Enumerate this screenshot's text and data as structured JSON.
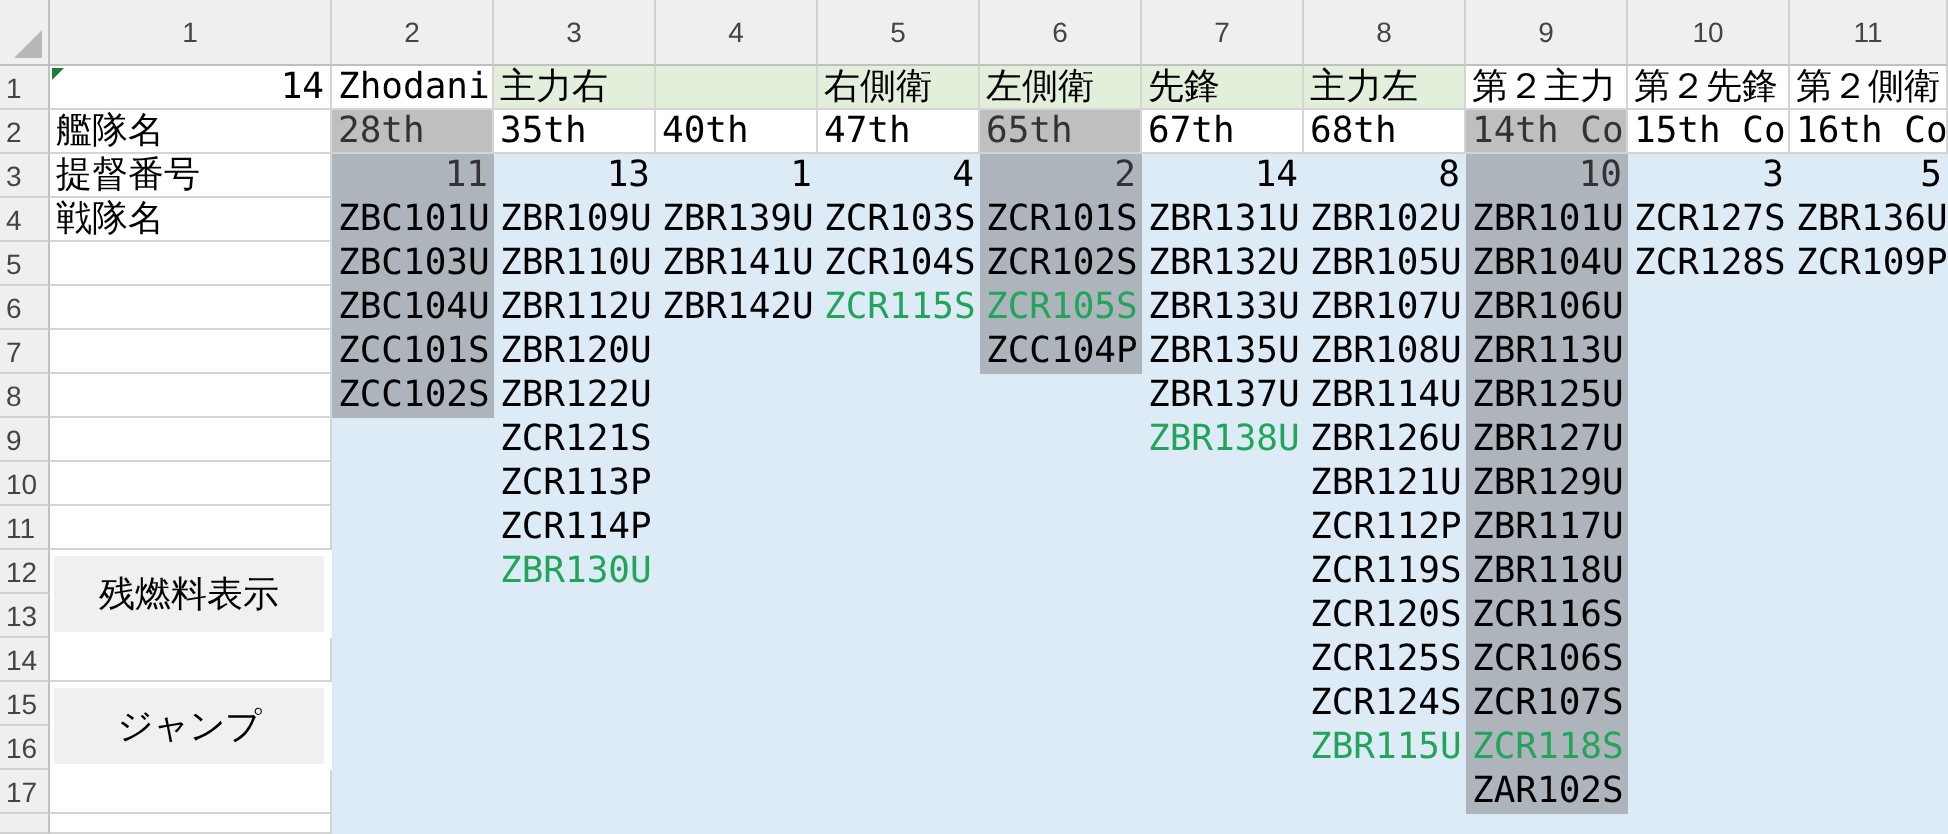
{
  "column_headers": [
    "1",
    "2",
    "3",
    "4",
    "5",
    "6",
    "7",
    "8",
    "9",
    "10",
    "11"
  ],
  "row_headers": [
    "1",
    "2",
    "3",
    "4",
    "5",
    "6",
    "7",
    "8",
    "9",
    "10",
    "11",
    "12",
    "13",
    "14",
    "15",
    "16",
    "17"
  ],
  "corner_value": "14",
  "row_labels": [
    "艦隊名",
    "提督番号",
    "戦隊名"
  ],
  "buttons": [
    "残燃料表示",
    "ジャンプ"
  ],
  "squadrons": [
    {
      "title": "Zhodani",
      "title_highlight": false,
      "fleet": "28th",
      "count": "11",
      "selected": true,
      "ships": [
        {
          "name": "ZBC101U",
          "color": "#000000"
        },
        {
          "name": "ZBC103U",
          "color": "#000000"
        },
        {
          "name": "ZBC104U",
          "color": "#000000"
        },
        {
          "name": "ZCC101S",
          "color": "#000000"
        },
        {
          "name": "ZCC102S",
          "color": "#000000"
        }
      ]
    },
    {
      "title": "主力右",
      "title_highlight": true,
      "fleet": "35th",
      "count": "13",
      "selected": false,
      "ships": [
        {
          "name": "ZBR109U",
          "color": "#000000"
        },
        {
          "name": "ZBR110U",
          "color": "#000000"
        },
        {
          "name": "ZBR112U",
          "color": "#000000"
        },
        {
          "name": "ZBR120U",
          "color": "#000000"
        },
        {
          "name": "ZBR122U",
          "color": "#000000"
        },
        {
          "name": "ZCR121S",
          "color": "#000000"
        },
        {
          "name": "ZCR113P",
          "color": "#000000"
        },
        {
          "name": "ZCR114P",
          "color": "#000000"
        },
        {
          "name": "ZBR130U",
          "color": "#22a55a"
        }
      ]
    },
    {
      "title_highlight": true,
      "fleet": "40th",
      "count": "1",
      "selected": false,
      "ships": [
        {
          "name": "ZBR139U",
          "color": "#000000"
        },
        {
          "name": "ZBR141U",
          "color": "#000000"
        },
        {
          "name": "ZBR142U",
          "color": "#000000"
        }
      ]
    },
    {
      "title": "右側衛",
      "title_highlight": true,
      "fleet": "47th",
      "count": "4",
      "selected": false,
      "ships": [
        {
          "name": "ZCR103S",
          "color": "#000000"
        },
        {
          "name": "ZCR104S",
          "color": "#000000"
        },
        {
          "name": "ZCR115S",
          "color": "#22a55a"
        }
      ]
    },
    {
      "title": "左側衛",
      "title_highlight": true,
      "fleet": "65th",
      "count": "2",
      "selected": true,
      "ships": [
        {
          "name": "ZCR101S",
          "color": "#000000"
        },
        {
          "name": "ZCR102S",
          "color": "#000000"
        },
        {
          "name": "ZCR105S",
          "color": "#22a55a"
        },
        {
          "name": "ZCC104P",
          "color": "#000000"
        }
      ]
    },
    {
      "title": "先鋒",
      "title_highlight": true,
      "fleet": "67th",
      "count": "14",
      "selected": false,
      "ships": [
        {
          "name": "ZBR131U",
          "color": "#000000"
        },
        {
          "name": "ZBR132U",
          "color": "#000000"
        },
        {
          "name": "ZBR133U",
          "color": "#000000"
        },
        {
          "name": "ZBR135U",
          "color": "#000000"
        },
        {
          "name": "ZBR137U",
          "color": "#000000"
        },
        {
          "name": "ZBR138U",
          "color": "#22a55a"
        }
      ]
    },
    {
      "title": "主力左",
      "title_highlight": true,
      "fleet": "68th",
      "count": "8",
      "selected": false,
      "ships": [
        {
          "name": "ZBR102U",
          "color": "#000000"
        },
        {
          "name": "ZBR105U",
          "color": "#000000"
        },
        {
          "name": "ZBR107U",
          "color": "#000000"
        },
        {
          "name": "ZBR108U",
          "color": "#000000"
        },
        {
          "name": "ZBR114U",
          "color": "#000000"
        },
        {
          "name": "ZBR126U",
          "color": "#000000"
        },
        {
          "name": "ZBR121U",
          "color": "#000000"
        },
        {
          "name": "ZCR112P",
          "color": "#000000"
        },
        {
          "name": "ZCR119S",
          "color": "#000000"
        },
        {
          "name": "ZCR120S",
          "color": "#000000"
        },
        {
          "name": "ZCR125S",
          "color": "#000000"
        },
        {
          "name": "ZCR124S",
          "color": "#000000"
        },
        {
          "name": "ZBR115U",
          "color": "#22a55a"
        }
      ]
    },
    {
      "title": "第２主力",
      "title_highlight": false,
      "fleet": "14th Co",
      "count": "10",
      "selected": true,
      "ships": [
        {
          "name": "ZBR101U",
          "color": "#000000"
        },
        {
          "name": "ZBR104U",
          "color": "#000000"
        },
        {
          "name": "ZBR106U",
          "color": "#000000"
        },
        {
          "name": "ZBR113U",
          "color": "#000000"
        },
        {
          "name": "ZBR125U",
          "color": "#000000"
        },
        {
          "name": "ZBR127U",
          "color": "#000000"
        },
        {
          "name": "ZBR129U",
          "color": "#000000"
        },
        {
          "name": "ZBR117U",
          "color": "#000000"
        },
        {
          "name": "ZBR118U",
          "color": "#000000"
        },
        {
          "name": "ZCR116S",
          "color": "#000000"
        },
        {
          "name": "ZCR106S",
          "color": "#000000"
        },
        {
          "name": "ZCR107S",
          "color": "#000000"
        },
        {
          "name": "ZCR118S",
          "color": "#22a55a"
        },
        {
          "name": "ZAR102S",
          "color": "#000000"
        }
      ]
    },
    {
      "title": "第２先鋒",
      "title_highlight": false,
      "fleet": "15th Co",
      "count": "3",
      "selected": false,
      "ships": [
        {
          "name": "ZCR127S",
          "color": "#000000"
        },
        {
          "name": "ZCR128S",
          "color": "#000000"
        }
      ]
    },
    {
      "title": "第２側衛",
      "title_highlight": false,
      "fleet": "16th Co",
      "count": "5",
      "selected": false,
      "ships": [
        {
          "name": "ZBR136U",
          "color": "#000000"
        },
        {
          "name": "ZCR109P",
          "color": "#000000"
        }
      ]
    }
  ]
}
